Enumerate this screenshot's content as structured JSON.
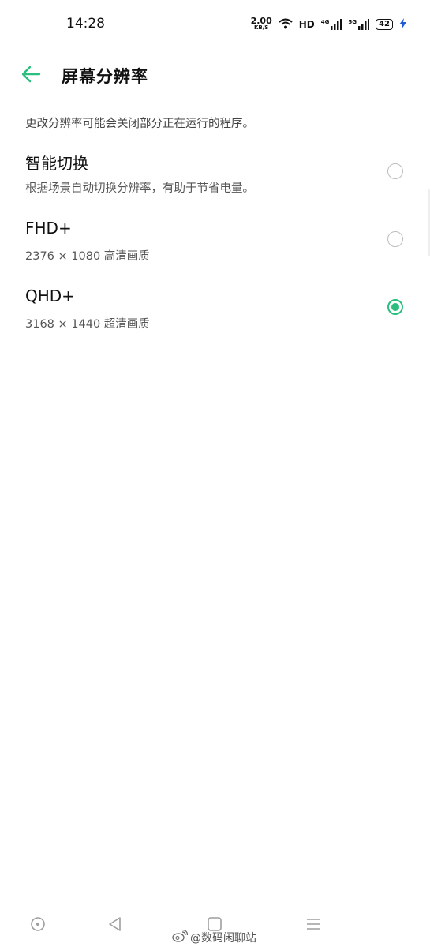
{
  "status_bar": {
    "time": "14:28",
    "net_speed_value": "2.00",
    "net_speed_unit": "KB/S",
    "hd_label": "HD",
    "signal1_label": "4G",
    "signal2_label": "5G",
    "battery": "42"
  },
  "header": {
    "title": "屏幕分辨率"
  },
  "note": "更改分辨率可能会关闭部分正在运行的程序。",
  "options": [
    {
      "title": "智能切换",
      "subtitle": "根据场景自动切换分辨率，有助于节省电量。",
      "selected": false
    },
    {
      "title": "FHD+",
      "subtitle": "2376 × 1080 高清画质",
      "selected": false
    },
    {
      "title": "QHD+",
      "subtitle": "3168 × 1440 超清画质",
      "selected": true
    }
  ],
  "watermark": "@数码闲聊站",
  "colors": {
    "accent": "#2bbf7f"
  }
}
